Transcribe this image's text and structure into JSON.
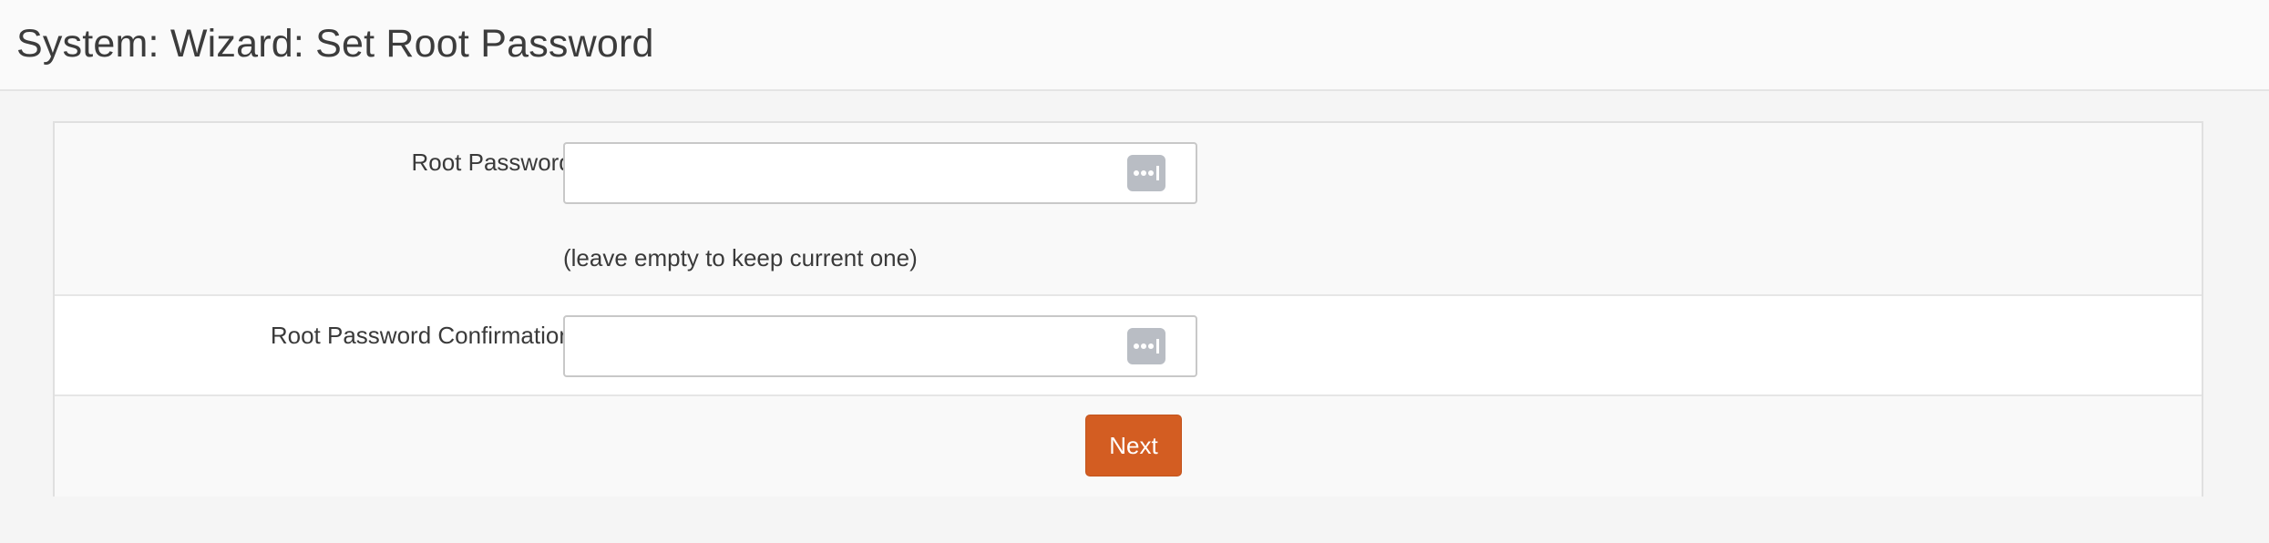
{
  "header": {
    "title": "System: Wizard: Set Root Password"
  },
  "form": {
    "root_password": {
      "label": "Root Password:",
      "value": "",
      "help": "(leave empty to keep current one)",
      "icon": "password-manager-key-icon"
    },
    "root_password_confirm": {
      "label": "Root Password Confirmation:",
      "value": "",
      "icon": "password-manager-key-icon"
    },
    "next_label": "Next"
  },
  "colors": {
    "accent": "#d35d22",
    "icon_bg": "#b9bdc4",
    "page_bg": "#f5f5f5"
  }
}
